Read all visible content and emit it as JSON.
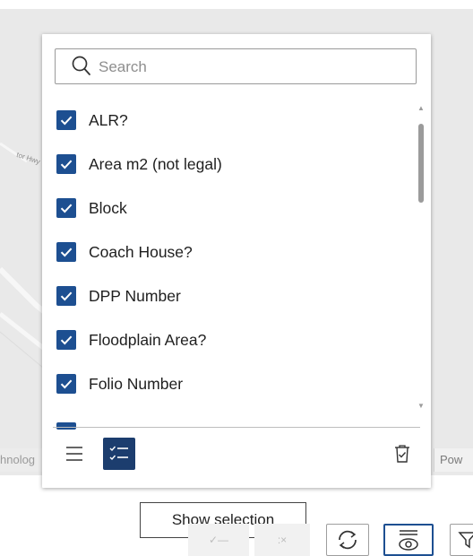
{
  "map": {
    "road_label": "tor Hwy",
    "attribution_left": "hnolog",
    "attribution_right": "Pow"
  },
  "search": {
    "placeholder": "Search",
    "value": ""
  },
  "fields": [
    {
      "label": "ALR?",
      "checked": true
    },
    {
      "label": "Area m2 (not legal)",
      "checked": true
    },
    {
      "label": "Block",
      "checked": true
    },
    {
      "label": "Coach House?",
      "checked": true
    },
    {
      "label": "DPP Number",
      "checked": true
    },
    {
      "label": "Floodplain Area?",
      "checked": true
    },
    {
      "label": "Folio Number",
      "checked": true
    }
  ],
  "footer": {
    "list_icon": "list-icon",
    "show_selection_icon": "checklist-icon",
    "clear_icon": "trash-check-icon"
  },
  "tooltip": {
    "text": "Show selection"
  },
  "toolbar": {
    "items": [
      "select-all-icon",
      "deselect-icon",
      "refresh-icon",
      "show-fields-icon",
      "filter-icon"
    ]
  },
  "colors": {
    "checkbox": "#1d4f91",
    "active_button": "#1c3d6e",
    "accent": "#1d4f91"
  }
}
